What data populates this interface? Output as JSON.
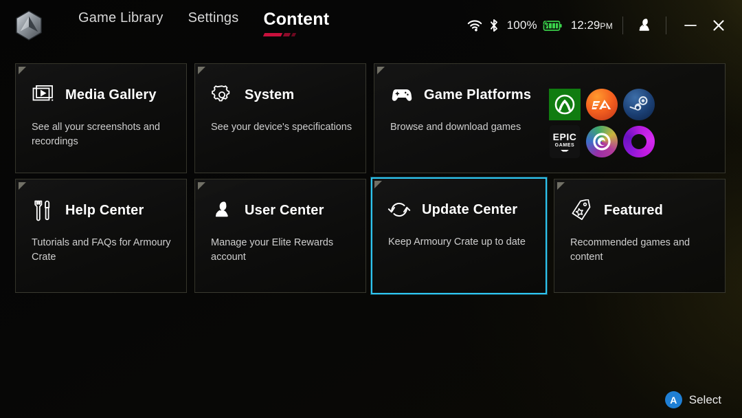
{
  "app": {
    "logo": "rog-hex-logo",
    "accent_red": "#c8103c",
    "accent_selected": "#2ec5f0"
  },
  "nav": {
    "items": [
      {
        "label": "Game Library",
        "active": false
      },
      {
        "label": "Settings",
        "active": false
      },
      {
        "label": "Content",
        "active": true
      }
    ]
  },
  "status": {
    "wifi_icon": "wifi-icon",
    "bluetooth_icon": "bluetooth-icon",
    "battery_percent": "100%",
    "battery_icon": "battery-charging-icon",
    "battery_color": "#3ad14a",
    "time": "12:29",
    "time_ampm": "PM",
    "avatar_icon": "user-avatar-icon",
    "minimize_icon": "minimize-icon",
    "close_icon": "close-icon"
  },
  "cards": [
    {
      "id": "media-gallery",
      "icon": "media-play-frame-icon",
      "title": "Media Gallery",
      "desc": "See all your screenshots and recordings",
      "selected": false
    },
    {
      "id": "system",
      "icon": "gear-icon",
      "title": "System",
      "desc": "See your device's specifications",
      "selected": false
    },
    {
      "id": "game-platforms",
      "icon": "gamepad-icon",
      "title": "Game Platforms",
      "desc": "Browse and download games",
      "selected": false,
      "platforms": [
        {
          "id": "xbox",
          "name": "Xbox",
          "color": "#107c10"
        },
        {
          "id": "ea",
          "name": "EA",
          "color": "#f4601f"
        },
        {
          "id": "steam",
          "name": "Steam",
          "color": "#1b3f73"
        },
        {
          "id": "epic",
          "name": "Epic Games",
          "color": "#121212",
          "line1": "EPIC",
          "line2": "GAMES"
        },
        {
          "id": "ubisoft",
          "name": "Ubisoft",
          "color": "#3c6ec8"
        },
        {
          "id": "gog",
          "name": "GOG",
          "color": "#c11ae0"
        }
      ]
    },
    {
      "id": "help-center",
      "icon": "wrench-screwdriver-icon",
      "title": "Help Center",
      "desc": "Tutorials and FAQs for Armoury Crate",
      "selected": false
    },
    {
      "id": "user-center",
      "icon": "user-profile-icon",
      "title": "User Center",
      "desc": "Manage your Elite Rewards account",
      "selected": false
    },
    {
      "id": "update-center",
      "icon": "refresh-sync-icon",
      "title": "Update Center",
      "desc": "Keep Armoury Crate up to date",
      "selected": true
    },
    {
      "id": "featured",
      "icon": "tag-star-icon",
      "title": "Featured",
      "desc": "Recommended games and content",
      "selected": false
    }
  ],
  "footer": {
    "button_glyph": "A",
    "label": "Select"
  }
}
